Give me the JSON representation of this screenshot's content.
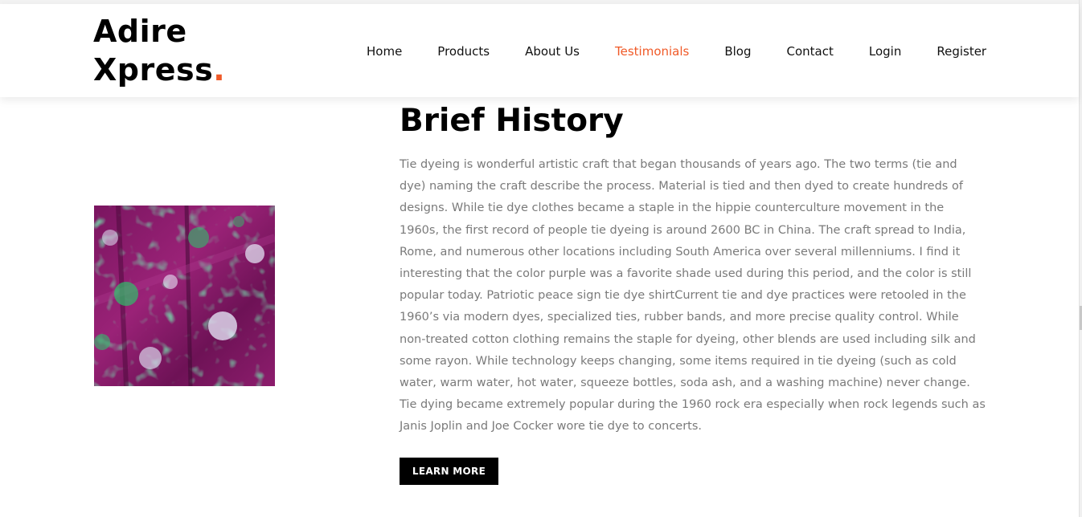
{
  "brand": {
    "line1": "Adire",
    "line2": "Xpress",
    "dot": ".",
    "accent_color": "#f05a28"
  },
  "nav": {
    "items": [
      {
        "label": "Home",
        "active": false
      },
      {
        "label": "Products",
        "active": false
      },
      {
        "label": "About Us",
        "active": false
      },
      {
        "label": "Testimonials",
        "active": true
      },
      {
        "label": "Blog",
        "active": false
      },
      {
        "label": "Contact",
        "active": false
      },
      {
        "label": "Login",
        "active": false
      },
      {
        "label": "Register",
        "active": false
      }
    ]
  },
  "section": {
    "title": "Brief History",
    "body": "Tie dyeing is wonderful artistic craft that began thousands of years ago. The two terms (tie and dye) naming the craft describe the process. Material is tied and then dyed to create hundreds of designs. While tie dye clothes became a staple in the hippie counterculture movement in the 1960s, the first record of people tie dyeing is around 2600 BC in China. The craft spread to India, Rome, and numerous other locations including South America over several millenniums. I find it interesting that the color purple was a favorite shade used during this period, and the color is still popular today. Patriotic peace sign tie dye shirtCurrent tie and dye practices were retooled in the 1960’s via modern dyes, specialized ties, rubber bands, and more precise quality control. While non-treated cotton clothing remains the staple for dyeing, other blends are used including silk and some rayon. While technology keeps changing, some items required in tie dyeing (such as cold water, warm water, hot water, squeeze bottles, soda ash, and a washing machine) never change. Tie dying became extremely popular during the 1960 rock era especially when rock legends such as Janis Joplin and Joe Cocker wore tie dye to concerts.",
    "button_label": "LEARN MORE"
  },
  "image": {
    "name": "tie-dye-fabric-image",
    "colors": [
      "#8a1a6a",
      "#5a1048",
      "#2fbf6a",
      "#d9d6ee",
      "#3a0a30"
    ]
  }
}
